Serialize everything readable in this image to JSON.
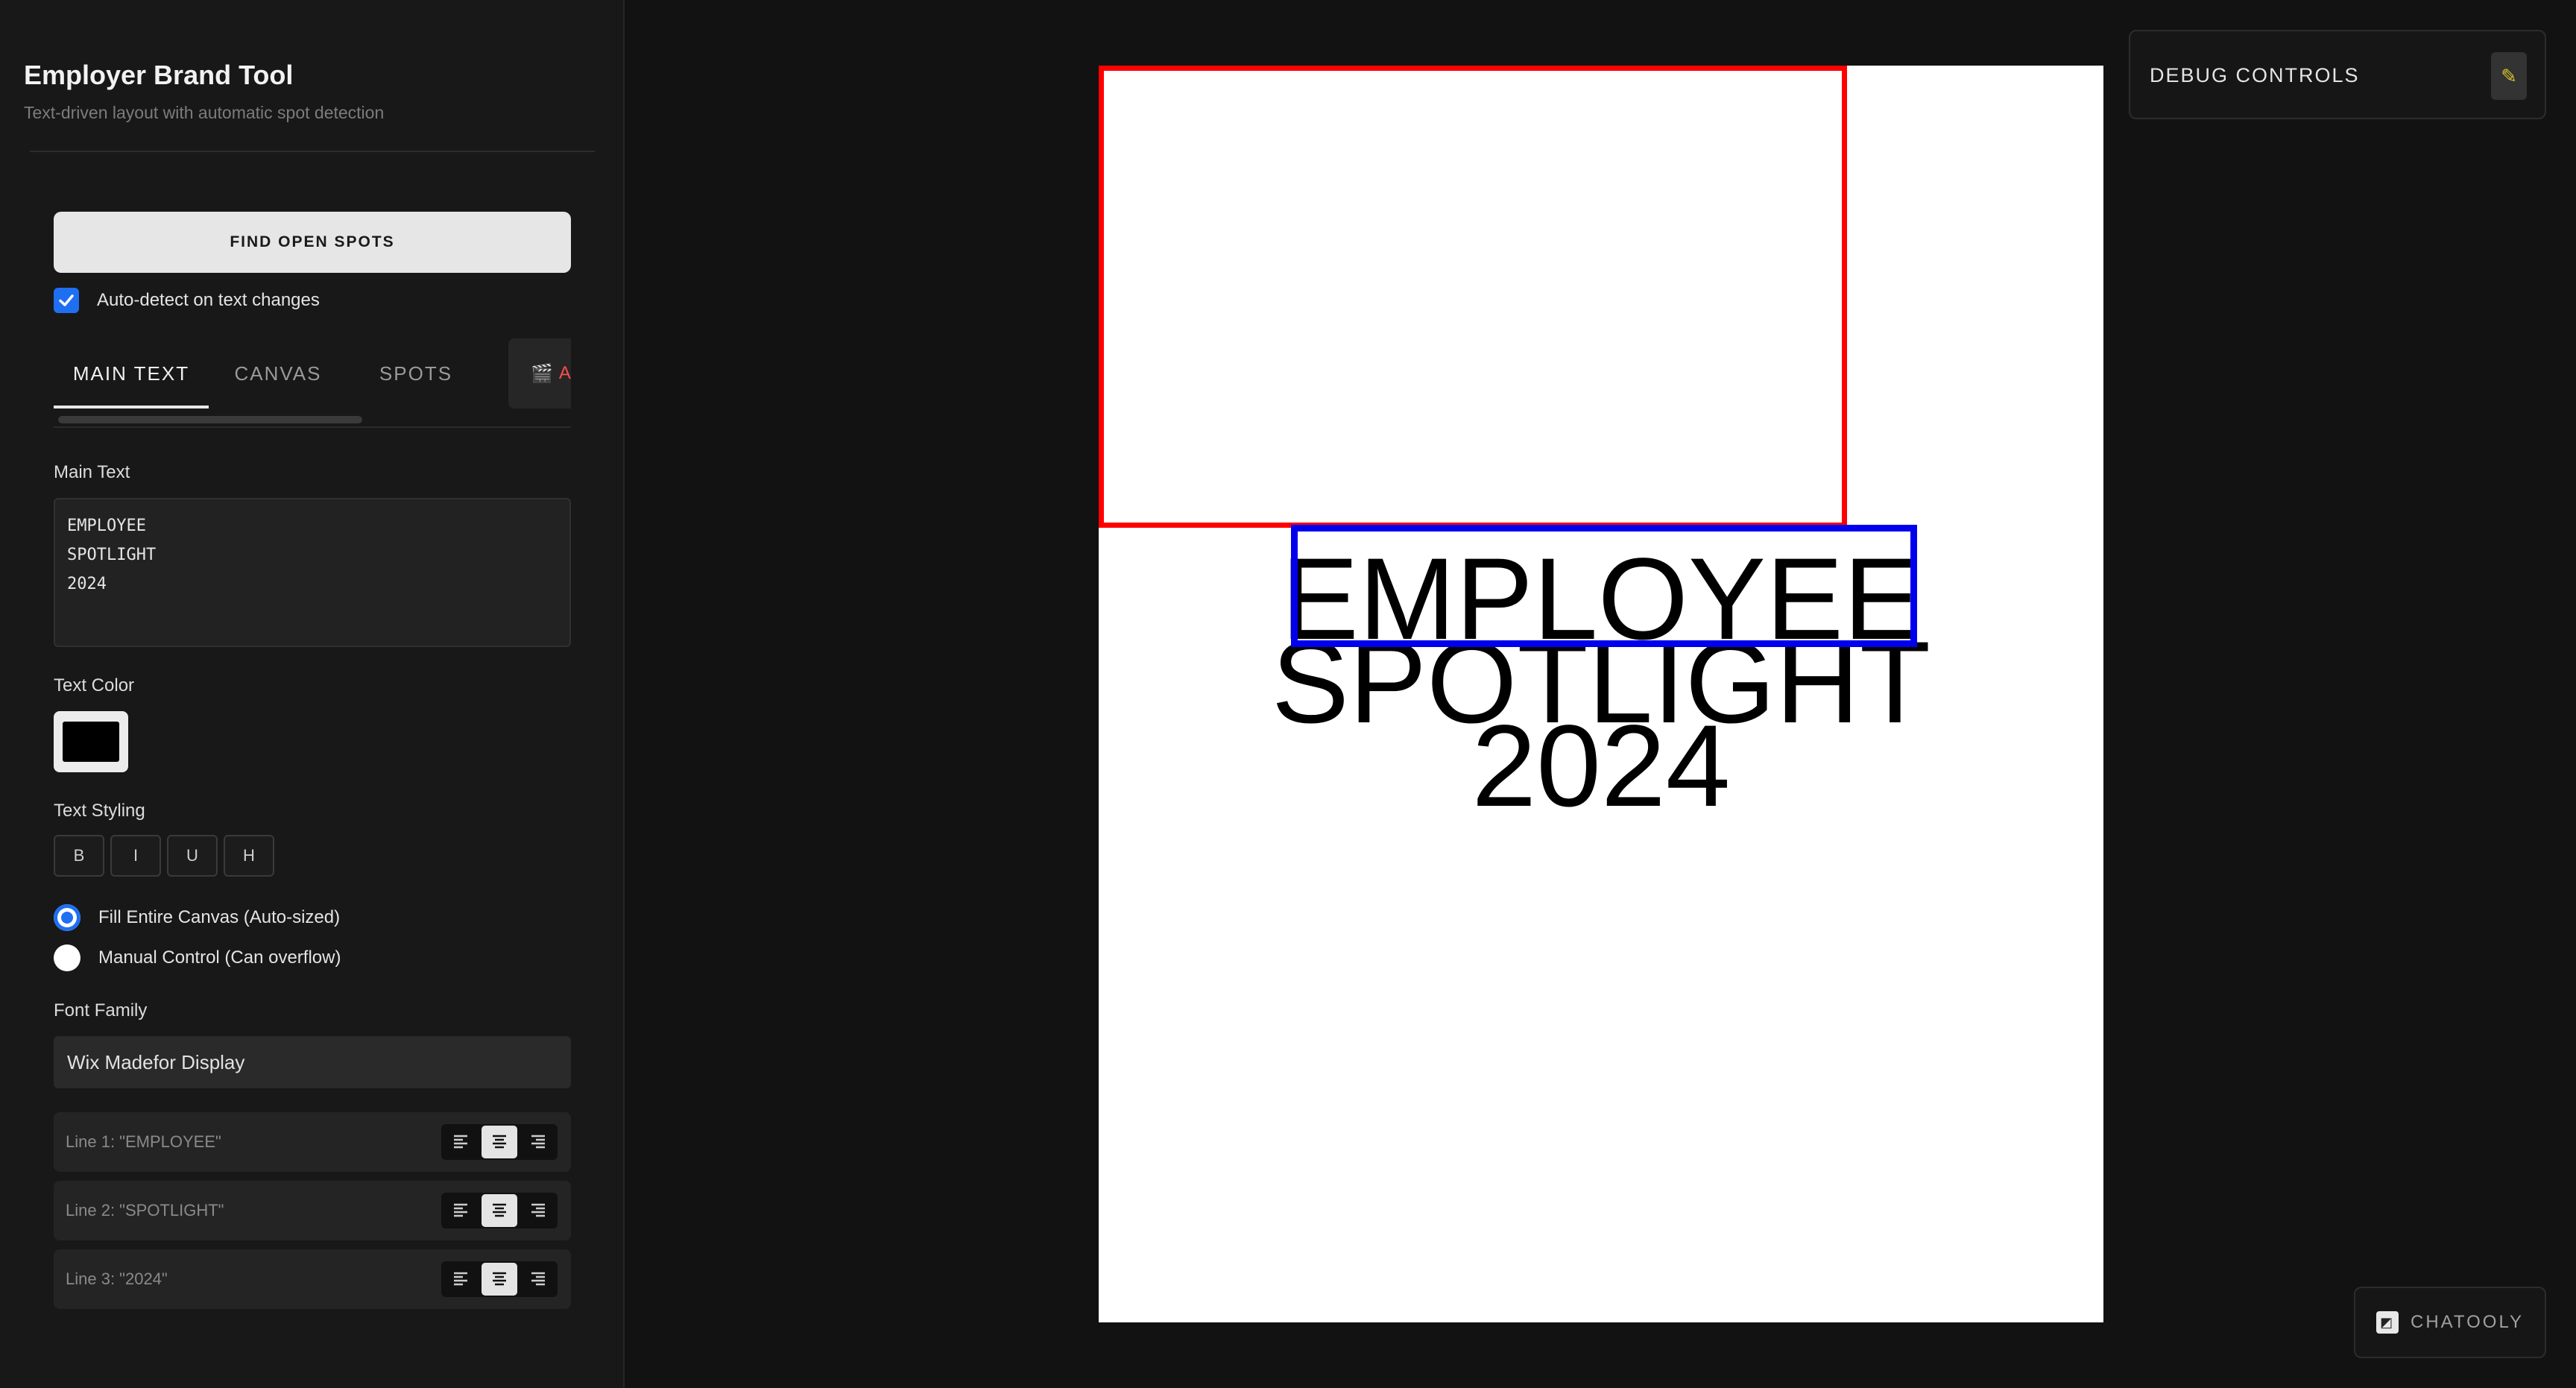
{
  "app": {
    "title": "Employer Brand Tool",
    "subtitle": "Text-driven layout with automatic spot detection"
  },
  "actions": {
    "find_spots_label": "FIND OPEN SPOTS",
    "auto_detect_label": "Auto-detect on text changes",
    "auto_detect_checked": true
  },
  "tabs": [
    {
      "label": "MAIN TEXT",
      "active": true
    },
    {
      "label": "CANVAS",
      "active": false
    },
    {
      "label": "SPOTS",
      "active": false
    },
    {
      "label": "A",
      "active": false,
      "icon": "clapper-icon"
    }
  ],
  "main_text": {
    "label": "Main Text",
    "value": "EMPLOYEE\nSPOTLIGHT\n2024",
    "lines": [
      "EMPLOYEE",
      "SPOTLIGHT",
      "2024"
    ]
  },
  "text_color": {
    "label": "Text Color",
    "value": "#000000"
  },
  "text_styling": {
    "label": "Text Styling",
    "buttons": [
      "B",
      "I",
      "U",
      "H"
    ]
  },
  "sizing_mode": {
    "options": [
      {
        "label": "Fill Entire Canvas (Auto-sized)",
        "selected": true
      },
      {
        "label": "Manual Control (Can overflow)",
        "selected": false
      }
    ]
  },
  "font_family": {
    "label": "Font Family",
    "value": "Wix Madefor Display"
  },
  "line_alignments": [
    {
      "label": "Line 1: \"EMPLOYEE\"",
      "align": "center"
    },
    {
      "label": "Line 2: \"SPOTLIGHT\"",
      "align": "center"
    },
    {
      "label": "Line 3: \"2024\"",
      "align": "center"
    }
  ],
  "debug": {
    "title": "DEBUG CONTROLS",
    "icon": "pencil-icon"
  },
  "chatooly": {
    "label": "CHATOOLY",
    "icon": "chatooly-logo-icon"
  },
  "colors": {
    "spot_red": "#ff0000",
    "spot_blue": "#0000ee",
    "accent": "#1e6ff2",
    "canvas_bg": "#ffffff"
  }
}
